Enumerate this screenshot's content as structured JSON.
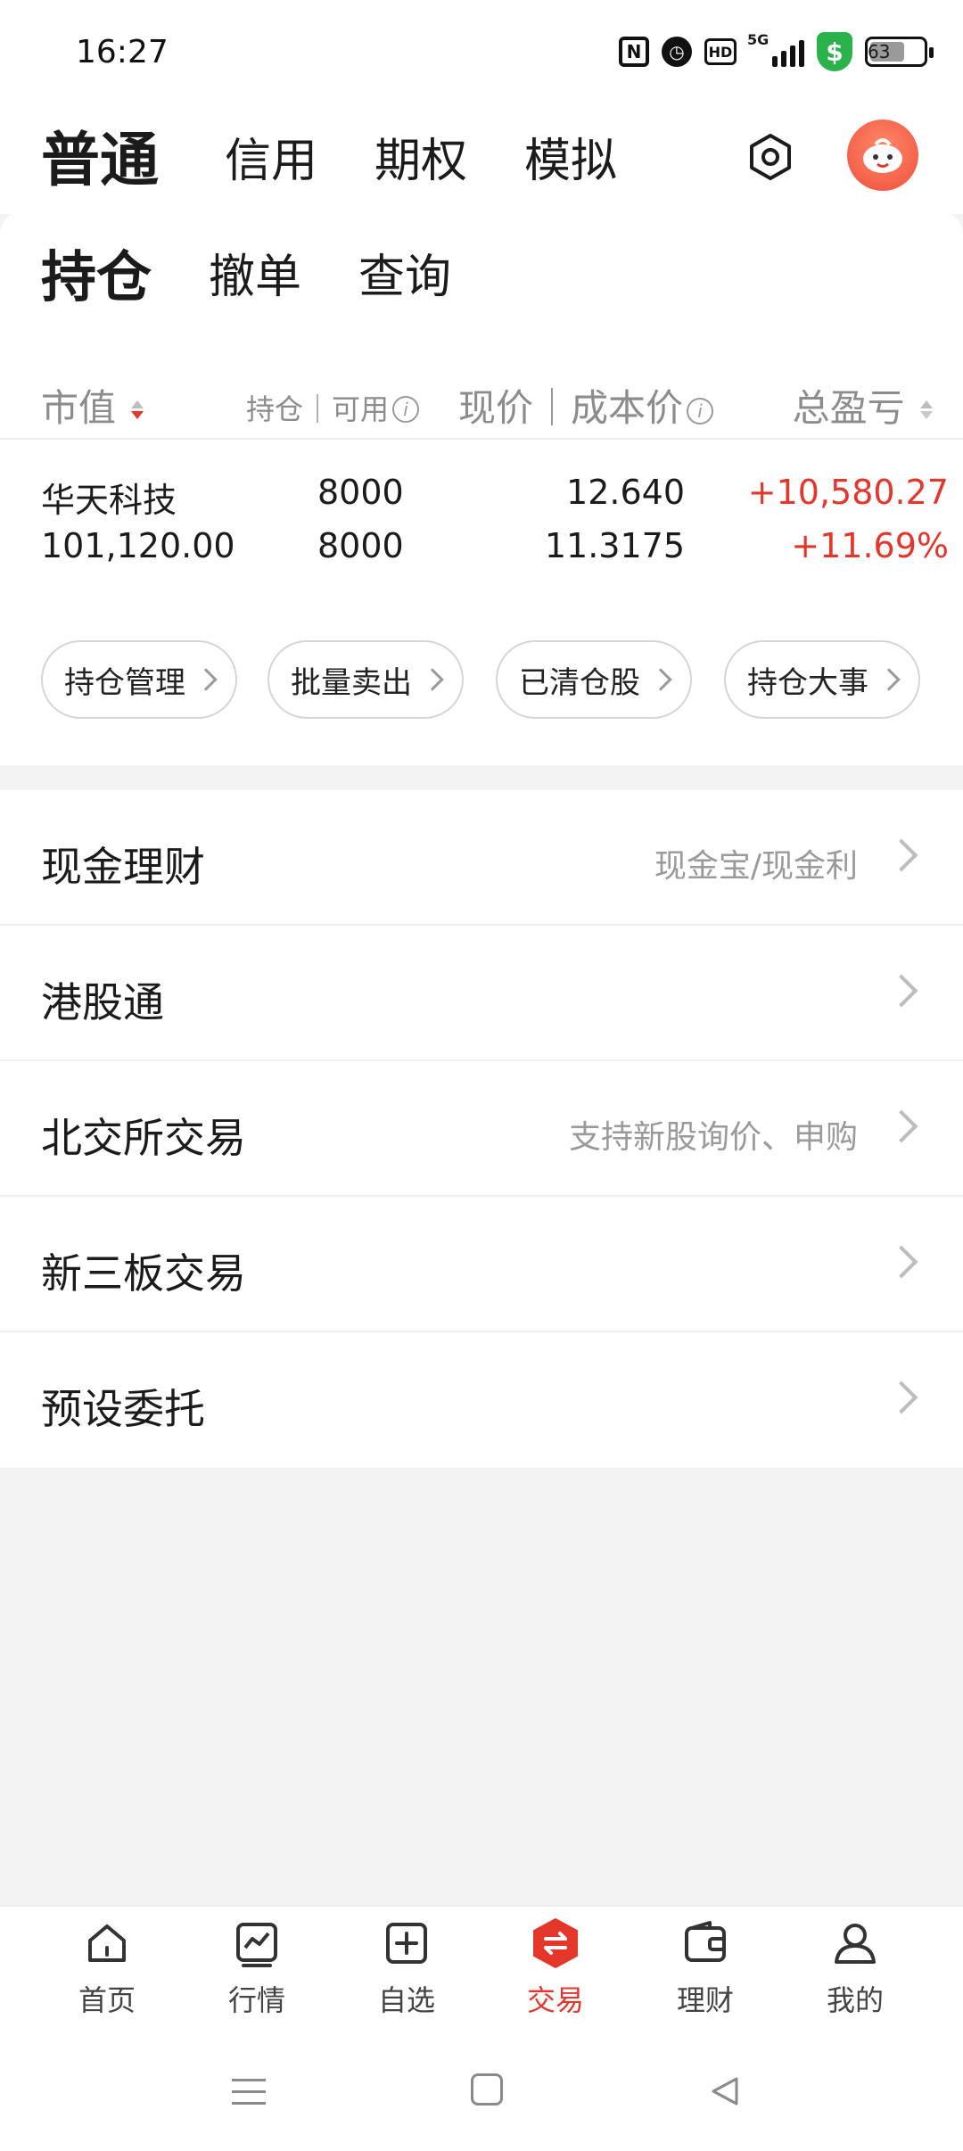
{
  "status_bar": {
    "time": "16:27",
    "network": "5G",
    "battery": "63",
    "icons": [
      "nfc-icon",
      "alarm-icon",
      "hd-icon",
      "signal-icon",
      "security-shield-icon",
      "battery-icon"
    ]
  },
  "top_tabs": {
    "items": [
      {
        "label": "普通",
        "active": true
      },
      {
        "label": "信用",
        "active": false
      },
      {
        "label": "期权",
        "active": false
      },
      {
        "label": "模拟",
        "active": false
      }
    ],
    "settings_icon": "settings-hexagon-icon",
    "avatar_icon": "mascot-avatar-icon"
  },
  "sub_tabs": {
    "items": [
      {
        "label": "持仓",
        "active": true
      },
      {
        "label": "撤单",
        "active": false
      },
      {
        "label": "查询",
        "active": false
      }
    ]
  },
  "positions": {
    "headers": {
      "market_value": "市值",
      "holding_available": "持仓｜可用",
      "price_cost": "现价｜成本价",
      "total_pnl": "总盈亏"
    },
    "rows": [
      {
        "name": "华天科技",
        "market_value": "101,120.00",
        "holding": "8000",
        "available": "8000",
        "price": "12.640",
        "cost": "11.3175",
        "pnl": "+10,580.27",
        "pnl_pct": "+11.69%"
      }
    ],
    "accent_color": "#e5362c"
  },
  "actions": [
    {
      "label": "持仓管理"
    },
    {
      "label": "批量卖出"
    },
    {
      "label": "已清仓股"
    },
    {
      "label": "持仓大事"
    }
  ],
  "menu": [
    {
      "label": "现金理财",
      "sub": "现金宝/现金利"
    },
    {
      "label": "港股通",
      "sub": ""
    },
    {
      "label": "北交所交易",
      "sub": "支持新股询价、申购"
    },
    {
      "label": "新三板交易",
      "sub": ""
    },
    {
      "label": "预设委托",
      "sub": ""
    }
  ],
  "bottom_nav": [
    {
      "label": "首页",
      "icon": "home-icon",
      "active": false
    },
    {
      "label": "行情",
      "icon": "chart-icon",
      "active": false
    },
    {
      "label": "自选",
      "icon": "add-watchlist-icon",
      "active": false
    },
    {
      "label": "交易",
      "icon": "trade-exchange-icon",
      "active": true
    },
    {
      "label": "理财",
      "icon": "wallet-icon",
      "active": false
    },
    {
      "label": "我的",
      "icon": "profile-icon",
      "active": false
    }
  ]
}
